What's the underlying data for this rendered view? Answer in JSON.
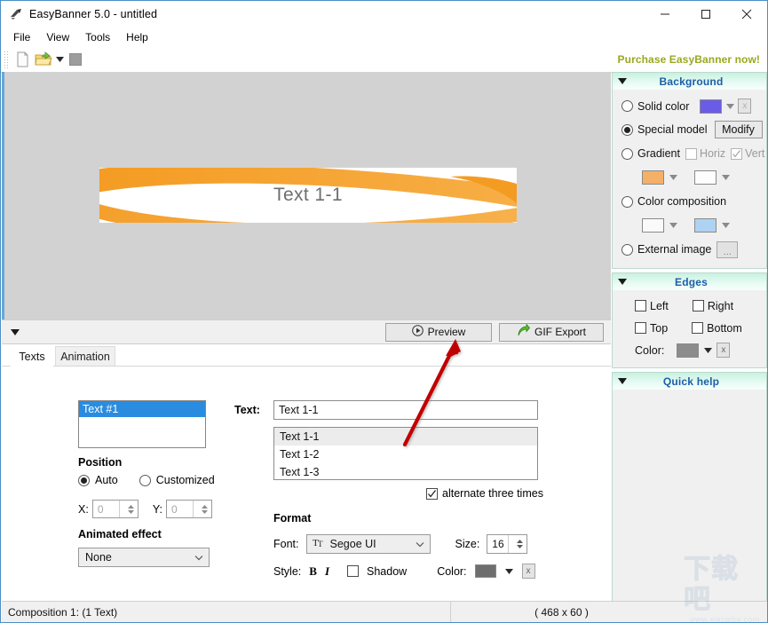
{
  "window": {
    "title": "EasyBanner 5.0 - untitled",
    "icon": "app-logo-icon",
    "minimize": "—",
    "maximize": "□",
    "close": "✕"
  },
  "menubar": {
    "items": [
      {
        "label": "File"
      },
      {
        "label": "View"
      },
      {
        "label": "Tools"
      },
      {
        "label": "Help"
      }
    ]
  },
  "toolbar": {
    "new_icon": "new-document-icon",
    "open_icon": "open-folder-icon",
    "open_dropdown_icon": "chevron-down-icon",
    "save_icon": "save-icon",
    "purchase_label": "Purchase EasyBanner now!"
  },
  "canvas": {
    "banner_text": "Text 1-1",
    "banner_bg": "#ffffff",
    "swoosh_color": "#F49B22",
    "area_bg": "#d2d2d2",
    "banner_size": "468 x 60"
  },
  "previewbar": {
    "collapse_icon": "triangle-down-icon",
    "preview_label": "Preview",
    "preview_icon": "play-circle-icon",
    "gif_export_label": "GIF Export",
    "gif_export_icon": "green-arrow-icon"
  },
  "tabs": [
    {
      "label": "Texts",
      "active": true
    },
    {
      "label": "Animation",
      "active": false
    }
  ],
  "editor": {
    "text_list": {
      "items": [
        {
          "label": "Text #1",
          "selected": true
        }
      ]
    },
    "position": {
      "heading": "Position",
      "auto_label": "Auto",
      "auto_selected": true,
      "customized_label": "Customized",
      "customized_selected": false,
      "x_label": "X:",
      "x_value": "0",
      "y_label": "Y:",
      "y_value": "0"
    },
    "animated_effect": {
      "heading": "Animated effect",
      "value": "None"
    },
    "text_field": {
      "label": "Text:",
      "value": "Text 1-1"
    },
    "lines": [
      {
        "label": "Text 1-1",
        "selected": true
      },
      {
        "label": "Text 1-2",
        "selected": false
      },
      {
        "label": "Text 1-3",
        "selected": false
      }
    ],
    "alternate": {
      "label": "alternate three times",
      "checked": true
    },
    "format": {
      "heading": "Format",
      "font_label": "Font:",
      "font_value": "Segoe UI",
      "font_icon": "font-glyph-icon",
      "size_label": "Size:",
      "size_value": "16",
      "style_label": "Style:",
      "bold_label": "B",
      "italic_label": "I",
      "shadow_label": "Shadow",
      "shadow_checked": false,
      "color_label": "Color:",
      "color_value": "#6e6e6e",
      "clear_label": "x"
    }
  },
  "sidebar": {
    "background": {
      "title": "Background",
      "collapse_icon": "triangle-down-icon",
      "solid_color": {
        "label": "Solid color",
        "selected": false,
        "swatch": "#6B5CE7",
        "clear_label": "x"
      },
      "special_model": {
        "label": "Special model",
        "selected": true,
        "button_label": "Modify"
      },
      "gradient": {
        "label": "Gradient",
        "selected": false,
        "horiz_label": "Horiz",
        "horiz_checked": false,
        "vert_label": "Vert",
        "vert_checked": true,
        "swatch_1": "#F5B067",
        "swatch_2": "#FDFDFD"
      },
      "color_composition": {
        "label": "Color composition",
        "selected": false,
        "swatch_1": "#FAFAFA",
        "swatch_2": "#AED3F2"
      },
      "external_image": {
        "label": "External image",
        "selected": false,
        "button_label": "..."
      }
    },
    "edges": {
      "title": "Edges",
      "collapse_icon": "triangle-down-icon",
      "left_label": "Left",
      "left_checked": false,
      "right_label": "Right",
      "right_checked": false,
      "top_label": "Top",
      "top_checked": false,
      "bottom_label": "Bottom",
      "bottom_checked": false,
      "color_label": "Color:",
      "color_value": "#8c8c8c",
      "clear_label": "x"
    },
    "quick_help": {
      "title": "Quick help",
      "collapse_icon": "triangle-down-icon"
    }
  },
  "statusbar": {
    "composition": "Composition 1:  (1 Text)",
    "dimensions": "( 468 x 60 )"
  },
  "watermark": {
    "big": "下载吧",
    "small": "www.xiazaiba.com"
  },
  "annotation": {
    "arrow_color": "#C00000"
  }
}
